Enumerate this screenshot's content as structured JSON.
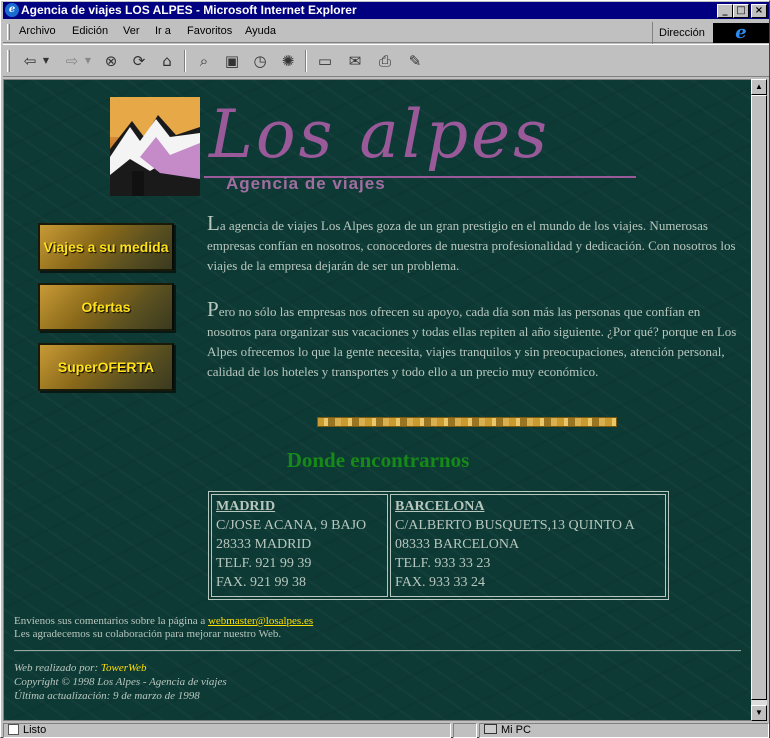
{
  "window": {
    "title": "Agencia de viajes LOS ALPES - Microsoft Internet Explorer",
    "minimize": "_",
    "maximize": "□",
    "close": "×"
  },
  "menu": {
    "items": [
      "Archivo",
      "Edición",
      "Ver",
      "Ir a",
      "Favoritos",
      "Ayuda"
    ],
    "address_label": "Dirección"
  },
  "page": {
    "logo": {
      "title": "Los alpes",
      "subtitle": "Agencia de viajes"
    },
    "nav": [
      {
        "label": "Viajes a su medida"
      },
      {
        "label": "Ofertas"
      },
      {
        "label": "SuperOFERTA"
      }
    ],
    "intro_p1_cap": "L",
    "intro_p1": "a agencia de viajes Los Alpes goza de un gran prestigio en el mundo de los viajes. Numerosas empresas confían en nosotros, conocedores de nuestra profesionalidad y dedicación. Con nosotros los viajes de la empresa dejarán de ser un problema.",
    "intro_p2_cap": "P",
    "intro_p2": "ero no sólo las empresas nos ofrecen su apoyo, cada día son más las personas que confían en nosotros para organizar sus vacaciones y todas ellas repiten al año siguiente. ¿Por qué? porque en Los Alpes ofrecemos lo que la gente necesita, viajes tranquilos y sin preocupaciones, atención personal, calidad de los hoteles y transportes y todo ello a un precio muy económico.",
    "donde_title": "Donde encontrarnos",
    "offices": [
      {
        "city": "MADRID",
        "street": "C/JOSE ACANA, 9 BAJO",
        "postal": "28333 MADRID",
        "phone": "TELF. 921 99 39",
        "fax": "FAX. 921 99 38"
      },
      {
        "city": "BARCELONA",
        "street": "C/ALBERTO BUSQUETS,13 QUINTO A",
        "postal": "08333 BARCELONA",
        "phone": "TELF. 933 33 23",
        "fax": "FAX. 933 33 24"
      }
    ],
    "comment_prefix": "Envíenos sus comentarios sobre la página a ",
    "comment_email": "webmaster@losalpes.es",
    "comment_thanks": "Les agradecemos su colaboración para mejorar nuestro Web.",
    "credits_prefix": "Web realizado por: ",
    "credits_author": "TowerWeb",
    "copyright": "Copyright © 1998 Los Alpes - Agencia de viajes",
    "last_update": "Última actualización: 9 de marzo de 1998"
  },
  "status": {
    "text": "Listo",
    "zone": "Mi PC"
  },
  "colors": {
    "page_bg": "#0e3a36",
    "logo_purple": "#9a5a9a",
    "nav_text": "#ffe21a",
    "heading_green": "#168a16",
    "link_yellow": "#ffe000"
  }
}
